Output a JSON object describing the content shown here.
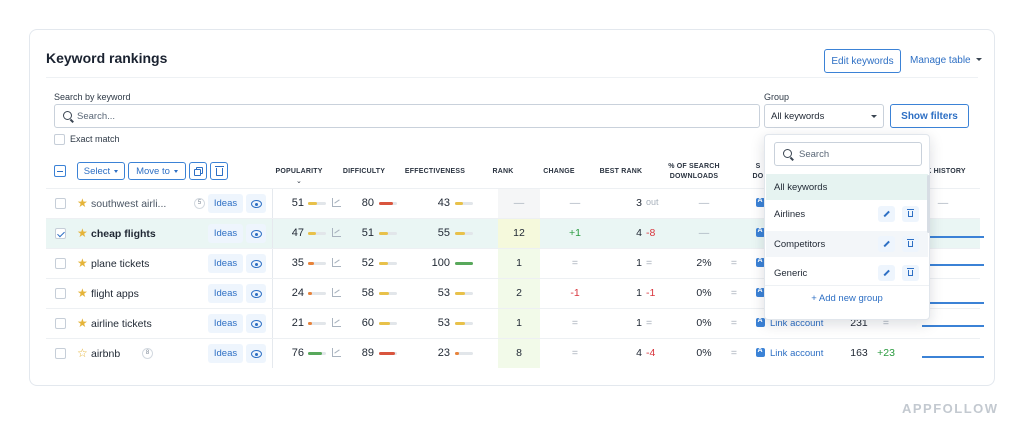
{
  "header": {
    "title": "Keyword rankings",
    "edit_keywords": "Edit keywords",
    "manage_table": "Manage table"
  },
  "filters": {
    "search_label": "Search by keyword",
    "search_placeholder": "Search...",
    "group_label": "Group",
    "group_value": "All keywords",
    "show_filters": "Show filters",
    "exact_match": "Exact match"
  },
  "toolbar": {
    "select": "Select",
    "move_to": "Move to"
  },
  "columns": {
    "popularity": "POPULARITY",
    "difficulty": "DIFFICULTY",
    "effectiveness": "EFFECTIVENESS",
    "rank": "RANK",
    "change": "CHANGE",
    "best_rank": "BEST RANK",
    "search_downloads_1": "% OF SEARCH",
    "search_downloads_2": "DOWNLOADS",
    "col_s": "S",
    "col_do": "DO",
    "rank_history": "K HISTORY"
  },
  "ideas_label": "Ideas",
  "rows": [
    {
      "keyword": "southwest airli...",
      "badge": "5",
      "starred": true,
      "selected": false,
      "muted": true,
      "popularity": "51",
      "pop_pct": 51,
      "difficulty": "80",
      "diff_pct": 80,
      "effectiveness": "43",
      "eff_pct": 43,
      "rank": "—",
      "change": "—",
      "best": "3",
      "best_change": "out",
      "downloads": "—",
      "dl_change": "",
      "link": "Li",
      "rank_now": "",
      "rank_change": "—"
    },
    {
      "keyword": "cheap flights",
      "badge": "",
      "starred": true,
      "selected": true,
      "muted": false,
      "popularity": "47",
      "pop_pct": 47,
      "difficulty": "51",
      "diff_pct": 51,
      "effectiveness": "55",
      "eff_pct": 55,
      "rank": "12",
      "change": "+1",
      "best": "4",
      "best_change": "-8",
      "downloads": "—",
      "dl_change": "",
      "link": "Li",
      "rank_now": "",
      "rank_change": ""
    },
    {
      "keyword": "plane tickets",
      "badge": "",
      "starred": true,
      "selected": false,
      "muted": false,
      "popularity": "35",
      "pop_pct": 35,
      "difficulty": "52",
      "diff_pct": 52,
      "effectiveness": "100",
      "eff_pct": 100,
      "rank": "1",
      "change": "=",
      "best": "1",
      "best_change": "=",
      "downloads": "2%",
      "dl_change": "=",
      "link": "Li",
      "rank_now": "",
      "rank_change": ""
    },
    {
      "keyword": "flight apps",
      "badge": "",
      "starred": true,
      "selected": false,
      "muted": false,
      "popularity": "24",
      "pop_pct": 24,
      "difficulty": "58",
      "diff_pct": 58,
      "effectiveness": "53",
      "eff_pct": 53,
      "rank": "2",
      "change": "-1",
      "best": "1",
      "best_change": "-1",
      "downloads": "0%",
      "dl_change": "=",
      "link": "Li",
      "rank_now": "",
      "rank_change": ""
    },
    {
      "keyword": "airline tickets",
      "badge": "",
      "starred": true,
      "selected": false,
      "muted": false,
      "popularity": "21",
      "pop_pct": 21,
      "difficulty": "60",
      "diff_pct": 60,
      "effectiveness": "53",
      "eff_pct": 53,
      "rank": "1",
      "change": "=",
      "best": "1",
      "best_change": "=",
      "downloads": "0%",
      "dl_change": "=",
      "link": "Link account",
      "rank_now": "231",
      "rank_change": "="
    },
    {
      "keyword": "airbnb",
      "badge": "8",
      "starred": false,
      "selected": false,
      "muted": false,
      "popularity": "76",
      "pop_pct": 76,
      "difficulty": "89",
      "diff_pct": 89,
      "effectiveness": "23",
      "eff_pct": 23,
      "rank": "8",
      "change": "=",
      "best": "4",
      "best_change": "-4",
      "downloads": "0%",
      "dl_change": "=",
      "link": "Link account",
      "rank_now": "163",
      "rank_change": "+23"
    }
  ],
  "dropdown": {
    "search_placeholder": "Search",
    "items": [
      {
        "label": "All keywords"
      },
      {
        "label": "Airlines"
      },
      {
        "label": "Competitors"
      },
      {
        "label": "Generic"
      }
    ],
    "add_group": "+ Add new group"
  },
  "watermark": "APPFOLLOW",
  "colors": {
    "accent": "#2d6fc4",
    "positive": "#2a9b3f",
    "negative": "#d9363e",
    "bar_green": "#58a85b",
    "bar_yellow": "#e8c14a",
    "bar_red": "#d9553e",
    "bar_orange": "#e8833a",
    "star": "#e5b43a"
  }
}
